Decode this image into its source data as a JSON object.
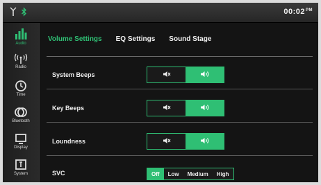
{
  "status": {
    "clock": "00:02",
    "clock_suffix": "PM",
    "icons": [
      "antenna-icon",
      "bluetooth-icon"
    ]
  },
  "sidebar": {
    "items": [
      {
        "label": "Audio",
        "icon": "equalizer-bars-icon",
        "active": true
      },
      {
        "label": "Radio",
        "icon": "radio-antenna-icon"
      },
      {
        "label": "Time",
        "icon": "clock-icon"
      },
      {
        "label": "Bluetooth",
        "icon": "bluetooth-link-icon"
      },
      {
        "label": "Display",
        "icon": "monitor-icon"
      },
      {
        "label": "System",
        "icon": "system-icon"
      }
    ]
  },
  "tabs": [
    {
      "label": "Volume Settings",
      "active": true
    },
    {
      "label": "EQ Settings"
    },
    {
      "label": "Sound Stage"
    }
  ],
  "settings": [
    {
      "label": "System Beeps",
      "options": [
        "mute-icon",
        "speaker-on-icon"
      ],
      "selected": 1
    },
    {
      "label": "Key Beeps",
      "options": [
        "mute-icon",
        "speaker-on-icon"
      ],
      "selected": 1
    },
    {
      "label": "Loundness",
      "options": [
        "mute-icon",
        "speaker-on-icon"
      ],
      "selected": 1
    }
  ],
  "svc": {
    "label": "SVC",
    "options": [
      "Off",
      "Low",
      "Medium",
      "High"
    ],
    "selected": "Off"
  },
  "colors": {
    "accent": "#2fbf74",
    "background": "#141414"
  }
}
